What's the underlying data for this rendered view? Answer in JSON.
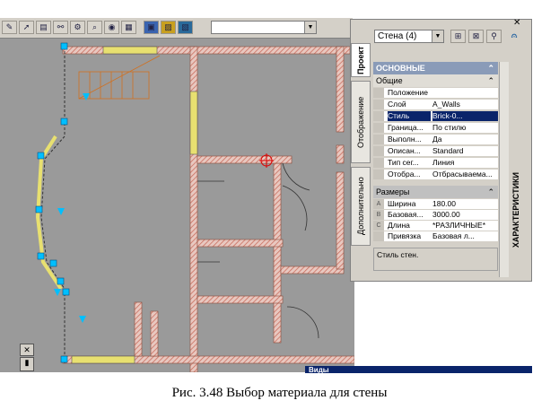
{
  "toolbar": {
    "combo_value": "",
    "icons": [
      "pen-icon",
      "pointer-icon",
      "layer-icon",
      "link-icon",
      "settings-icon",
      "zoom-icon",
      "camera-icon",
      "render-icon"
    ]
  },
  "properties_panel": {
    "tabs": [
      "Проект",
      "Отображение",
      "Дополнительно"
    ],
    "object_combo": "Стена (4)",
    "category_header": "ОСНОВНЫЕ",
    "general_header": "Общие",
    "general_rows": [
      {
        "label": "Положение",
        "value": "",
        "icon": "position-icon"
      },
      {
        "label": "Слой",
        "value": "A_Walls",
        "icon": "layer-icon"
      },
      {
        "label": "Стиль",
        "value": "Brick-0...",
        "icon": "style-swatch-icon"
      },
      {
        "label": "Граница...",
        "value": "По стилю",
        "icon": ""
      },
      {
        "label": "Выполн...",
        "value": "Да",
        "icon": ""
      },
      {
        "label": "Описан...",
        "value": "Standard",
        "icon": "standard-icon"
      },
      {
        "label": "Тип сег...",
        "value": "Линия",
        "icon": "line-icon"
      },
      {
        "label": "Отобра...",
        "value": "Отбрасываема...",
        "icon": ""
      }
    ],
    "dimensions_header": "Размеры",
    "dimension_rows": [
      {
        "key": "A",
        "label": "Ширина",
        "value": "180.00"
      },
      {
        "key": "B",
        "label": "Базовая...",
        "value": "3000.00"
      },
      {
        "key": "C",
        "label": "Длина",
        "value": "*РАЗЛИЧНЫЕ*"
      },
      {
        "key": "",
        "label": "Привязка",
        "value": "Базовая л..."
      }
    ],
    "description": "Стиль стен.",
    "side_title": "ХАРАКТЕРИСТИКИ"
  },
  "bottom_window": {
    "title": "Виды"
  },
  "caption": "Рис. 3.48 Выбор материала для стены",
  "colors": {
    "canvas": "#9a9a9a",
    "wall_hatch": "#d89a8a",
    "window_yellow": "#e8e070",
    "selection": "#00bfff",
    "stair": "#d07020",
    "highlight": "#0a246a"
  }
}
